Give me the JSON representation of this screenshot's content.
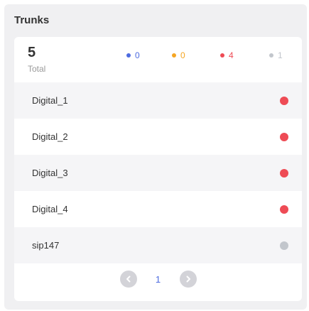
{
  "panel": {
    "title": "Trunks"
  },
  "summary": {
    "total": "5",
    "total_label": "Total",
    "stats": [
      {
        "value": "0",
        "color": "#4d6be0",
        "name": "blue"
      },
      {
        "value": "0",
        "color": "#f5a623",
        "name": "orange"
      },
      {
        "value": "4",
        "color": "#ee4b55",
        "name": "red"
      },
      {
        "value": "1",
        "color": "#c2c6cc",
        "name": "gray"
      }
    ]
  },
  "trunks": [
    {
      "name": "Digital_1",
      "status_color": "#ee4b55"
    },
    {
      "name": "Digital_2",
      "status_color": "#ee4b55"
    },
    {
      "name": "Digital_3",
      "status_color": "#ee4b55"
    },
    {
      "name": "Digital_4",
      "status_color": "#ee4b55"
    },
    {
      "name": "sip147",
      "status_color": "#c2c6cc"
    }
  ],
  "pagination": {
    "current_page": "1",
    "prev_icon": "chevron-left-icon",
    "next_icon": "chevron-right-icon"
  }
}
